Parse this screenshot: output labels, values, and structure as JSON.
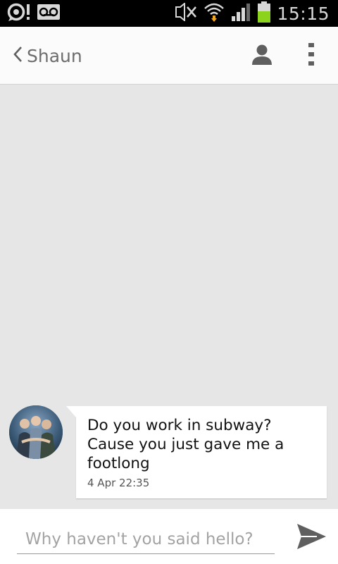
{
  "status_bar": {
    "time": "15:15",
    "icons": [
      "notification-icon",
      "voicemail-icon",
      "mute-icon",
      "wifi-icon",
      "signal-icon",
      "battery-icon"
    ],
    "battery_color": "#8cd31e"
  },
  "header": {
    "contact_name": "Shaun",
    "icons": [
      "back-chevron-icon",
      "contact-person-icon",
      "overflow-menu-icon"
    ]
  },
  "conversation": {
    "messages": [
      {
        "direction": "incoming",
        "text": "Do you work in subway? Cause you just gave me a footlong",
        "timestamp": "4 Apr  22:35"
      }
    ]
  },
  "compose": {
    "placeholder": "Why haven't you said hello?",
    "value": "",
    "send_icon": "send-icon"
  },
  "colors": {
    "background": "#e6e6e6",
    "header": "#fbfbfb",
    "icon_gray": "#5f5f5f"
  }
}
